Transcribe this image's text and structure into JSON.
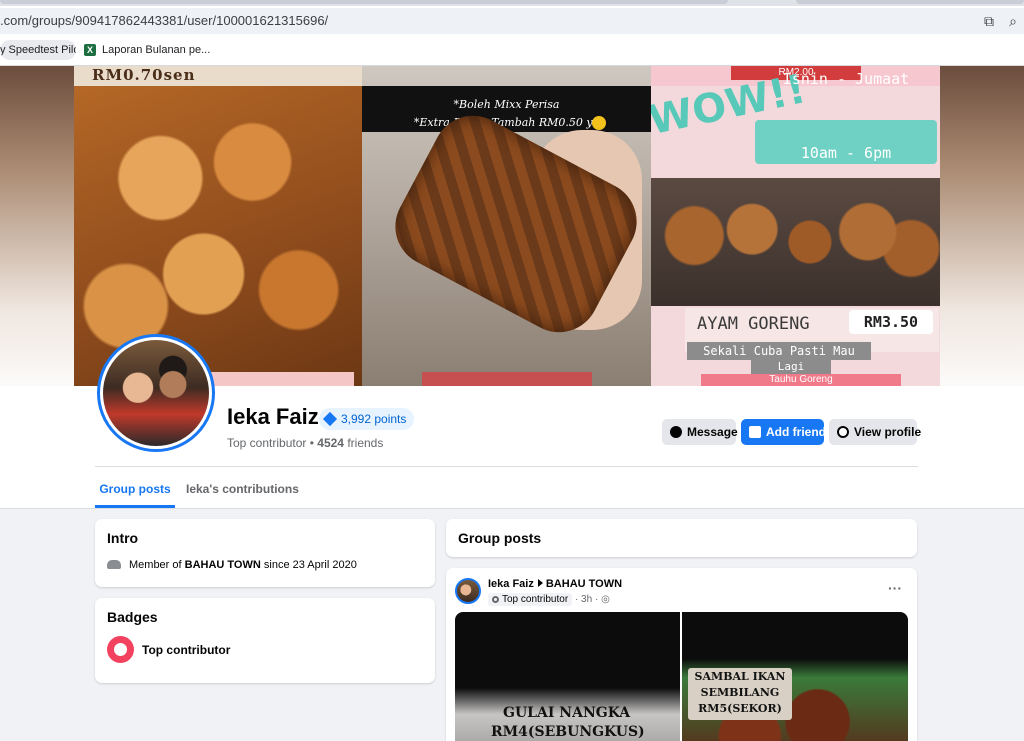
{
  "browser": {
    "url": ".com/groups/909417862443381/user/100001621315696/",
    "bookmarks": [
      {
        "label": "y Speedtest Pilo..."
      },
      {
        "label": "Laporan Bulanan pe..."
      }
    ],
    "icons": [
      "install-app-icon",
      "zoom-icon",
      "excel-icon"
    ]
  },
  "cover": {
    "left_price": "RM0.70sen",
    "middle_caption_1": "*Boleh Mixx Perisa",
    "middle_caption_2": "*Extra Perisa Tambah RM0.50 ye",
    "right_top": "RM2.00",
    "right_wow": "WOW!!",
    "right_hours_1": "Isnin - Jumaat",
    "right_hours_2": "10am - 6pm",
    "right_name": "AYAM GORENG",
    "right_price": "RM3.50",
    "right_tagline_1": "Sekali Cuba Pasti Mau",
    "right_tagline_2": "Lagi",
    "right_tagline_3": "Tauhu Goreng"
  },
  "profile": {
    "name": "Ieka Faiz",
    "points": "3,992 points",
    "role": "Top contributor",
    "separator": "•",
    "friends_count": "4524",
    "friends_label": "friends"
  },
  "actions": {
    "message": "Message",
    "add_friend": "Add friend",
    "view_profile": "View profile"
  },
  "tabs": {
    "group_posts": "Group posts",
    "contributions": "Ieka's contributions",
    "more": "···"
  },
  "intro": {
    "title": "Intro",
    "member_prefix": "Member of",
    "group": "BAHAU TOWN",
    "since": "since 23 April 2020"
  },
  "badges": {
    "title": "Badges",
    "badge": "Top contributor"
  },
  "posts": {
    "title": "Group posts",
    "post": {
      "author": "Ieka Faiz",
      "group": "BAHAU TOWN",
      "badge": "Top contributor",
      "time": "· 3h ·",
      "more": "···",
      "img_left_line1": "GULAI NANGKA",
      "img_left_line2": "RM4(SEBUNGKUS)",
      "img_right_line1": "SAMBAL IKAN",
      "img_right_line2": "SEMBILANG",
      "img_right_line3": "RM5(SEKOR)"
    }
  },
  "colors": {
    "accent": "#1877f2",
    "badge": "#f3425f",
    "background": "#f0f2f5"
  }
}
